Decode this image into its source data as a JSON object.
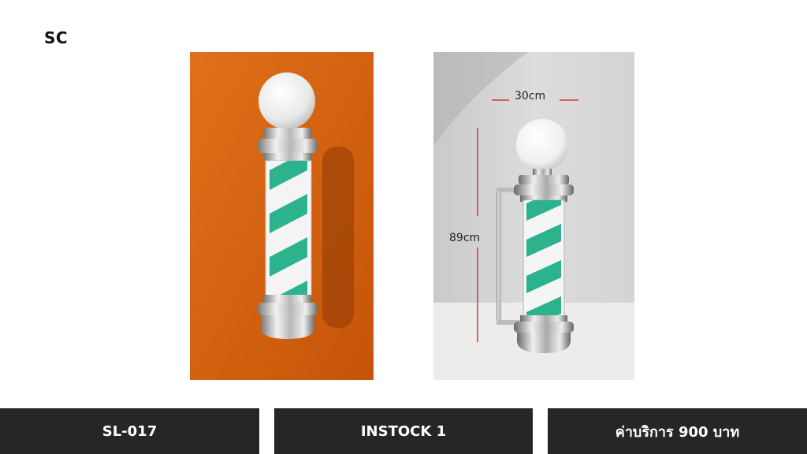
{
  "brand": "SC",
  "photos": [
    {
      "name": "barber-pole-front"
    },
    {
      "name": "barber-pole-side",
      "width_label": "30cm",
      "height_label": "89cm"
    }
  ],
  "bottom_bar": {
    "model": "SL-017",
    "stock": "INSTOCK 1",
    "price": "ค่าบริการ 900 บาท"
  }
}
